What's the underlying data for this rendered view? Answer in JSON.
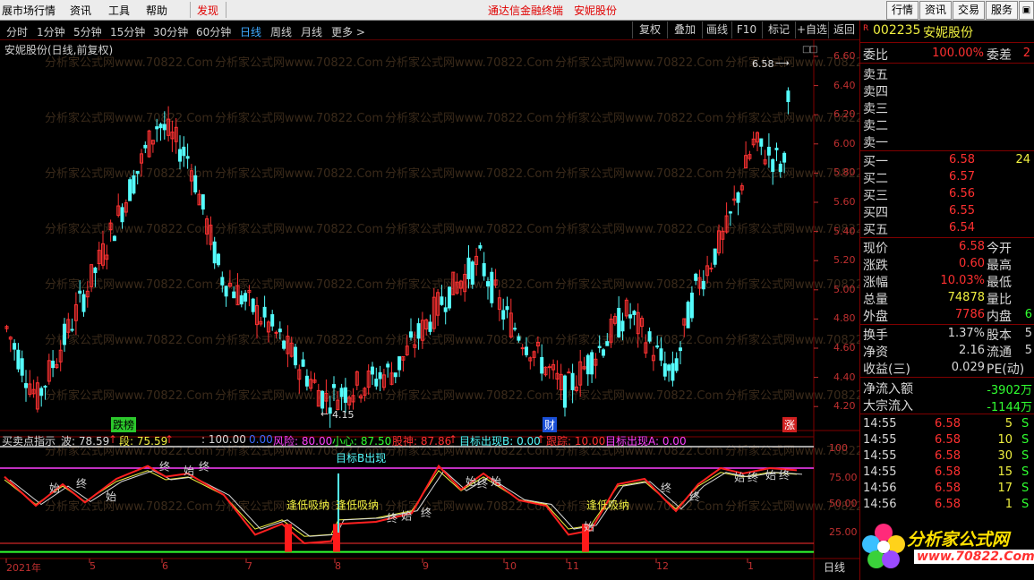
{
  "menubar": {
    "items": [
      "展市场行情",
      "资讯",
      "工具",
      "帮助"
    ],
    "discover": "发现",
    "center_title": "通达信金融终端",
    "center_stock": "安妮股份",
    "right_buttons": [
      "行情",
      "资讯",
      "交易",
      "服务"
    ]
  },
  "periodbar": {
    "periods": [
      "分时",
      "1分钟",
      "5分钟",
      "15分钟",
      "30分钟",
      "60分钟",
      "日线",
      "周线",
      "月线",
      "更多 >"
    ],
    "active": "日线",
    "tools": [
      "复权",
      "叠加",
      "画线",
      "F10",
      "标记",
      "+自选",
      "返回"
    ]
  },
  "chart": {
    "title": "安妮股份(日线,前复权)",
    "price_ticks": [
      "6.60",
      "6.40",
      "6.20",
      "6.00",
      "5.80",
      "5.60",
      "5.40",
      "5.20",
      "5.00",
      "4.80",
      "4.60",
      "4.40",
      "4.20"
    ],
    "high_label": "6.58",
    "low_label": "4.15",
    "markers": {
      "m1": "跌榜",
      "m2": "财",
      "m3": "涨"
    },
    "date_labels": [
      "2021年",
      "5",
      "6",
      "7",
      "8",
      "9",
      "10",
      "11",
      "12",
      "1"
    ],
    "period_label": "日线",
    "watermark": "分析家公式网www.70822.Com",
    "colors": {
      "up": "#ff3232",
      "down": "#54fcfc",
      "bg": "#000000"
    }
  },
  "indicator": {
    "name": "买卖点指示",
    "wave": "波: 78.59",
    "seg": "段: 75.59",
    "v100": ": 100.00",
    "v0": "0.00",
    "risk": "风险: 80.00",
    "careful": "小心: 87.50",
    "god": "股神: 87.86",
    "target_b": "目标出现B: 0.00",
    "track": "跟踪: 10.00",
    "target_a": "目标出现A: 0.00",
    "ticks": [
      "100",
      "75.00",
      "50.00",
      "25.00"
    ],
    "labels": [
      "始",
      "终",
      "始",
      "终",
      "始",
      "终",
      "目标B出现",
      "逢低吸纳",
      "逢低吸纳",
      "终",
      "始",
      "终",
      "始",
      "终",
      "始",
      "终",
      "逢低吸纳",
      "始",
      "终",
      "始",
      "终",
      "始",
      "终"
    ]
  },
  "quote": {
    "code": "002235",
    "name": "安妮股份",
    "r_mark": "R",
    "weibi_label": "委比",
    "weibi": "100.00%",
    "weicha_label": "委差",
    "weicha": "2",
    "sell": [
      {
        "label": "卖五"
      },
      {
        "label": "卖四"
      },
      {
        "label": "卖三"
      },
      {
        "label": "卖二"
      },
      {
        "label": "卖一"
      }
    ],
    "buy": [
      {
        "label": "买一",
        "price": "6.58",
        "vol": "24"
      },
      {
        "label": "买二",
        "price": "6.57",
        "vol": ""
      },
      {
        "label": "买三",
        "price": "6.56",
        "vol": ""
      },
      {
        "label": "买四",
        "price": "6.55",
        "vol": ""
      },
      {
        "label": "买五",
        "price": "6.54",
        "vol": ""
      }
    ],
    "stats": [
      {
        "l1": "现价",
        "v1": "6.58",
        "l2": "今开"
      },
      {
        "l1": "涨跌",
        "v1": "0.60",
        "l2": "最高"
      },
      {
        "l1": "涨幅",
        "v1": "10.03%",
        "l2": "最低"
      },
      {
        "l1": "总量",
        "v1": "74878",
        "l2": "量比"
      },
      {
        "l1": "外盘",
        "v1": "7786",
        "l2": "内盘"
      }
    ],
    "inpan_v": "6",
    "stats2": [
      {
        "l1": "换手",
        "v1": "1.37%",
        "l2": "股本",
        "v2": "5"
      },
      {
        "l1": "净资",
        "v1": "2.16",
        "l2": "流通",
        "v2": "5"
      },
      {
        "l1": "收益(三)",
        "v1": "0.029",
        "l2": "PE(动)",
        "v2": ""
      }
    ],
    "netflow_label": "净流入额",
    "netflow": "-3902万",
    "bigflow_label": "大宗流入",
    "bigflow": "-1144万",
    "ticks": [
      {
        "t": "14:55",
        "p": "6.58",
        "v": "5",
        "s": "S"
      },
      {
        "t": "14:55",
        "p": "6.58",
        "v": "10",
        "s": "S"
      },
      {
        "t": "14:55",
        "p": "6.58",
        "v": "30",
        "s": "S"
      },
      {
        "t": "14:55",
        "p": "6.58",
        "v": "15",
        "s": "S"
      },
      {
        "t": "14:56",
        "p": "6.58",
        "v": "17",
        "s": "S"
      },
      {
        "t": "14:56",
        "p": "6.58",
        "v": "1",
        "s": "S"
      }
    ],
    "logo_text": "分析家公式网",
    "logo_url": "www.70822.Com"
  }
}
